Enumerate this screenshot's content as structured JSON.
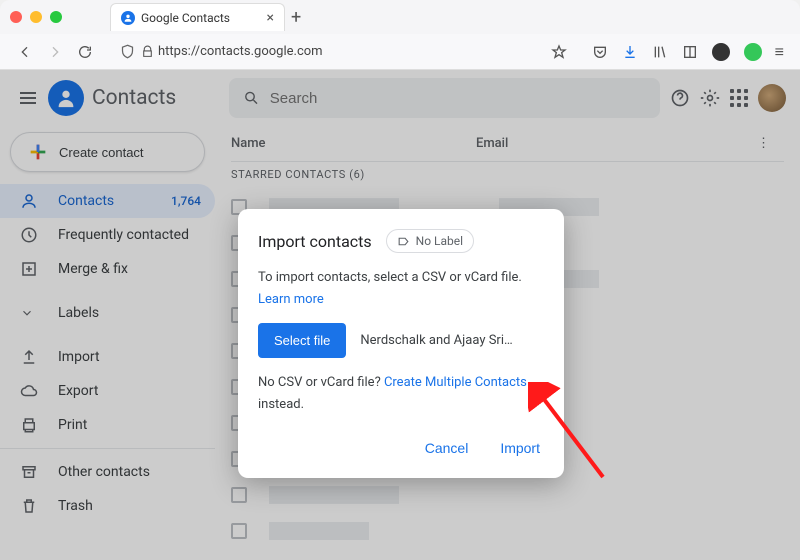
{
  "browser": {
    "tab_title": "Google Contacts",
    "url": "https://contacts.google.com"
  },
  "header": {
    "title": "Contacts"
  },
  "sidebar": {
    "create": "Create contact",
    "items": [
      {
        "label": "Contacts",
        "count": "1,764"
      },
      {
        "label": "Frequently contacted"
      },
      {
        "label": "Merge & fix"
      },
      {
        "label": "Labels"
      },
      {
        "label": "Import"
      },
      {
        "label": "Export"
      },
      {
        "label": "Print"
      },
      {
        "label": "Other contacts"
      },
      {
        "label": "Trash"
      }
    ]
  },
  "search": {
    "placeholder": "Search"
  },
  "table": {
    "name": "Name",
    "email": "Email",
    "section": "STARRED CONTACTS (6)"
  },
  "dialog": {
    "title": "Import contacts",
    "no_label": "No Label",
    "desc": "To import contacts, select a CSV or vCard file.",
    "learn_more": "Learn more",
    "select_file": "Select file",
    "filename": "Nerdschalk and Ajaay Srini…",
    "no_csv_pre": "No CSV or vCard file? ",
    "create_multiple": "Create Multiple Contacts",
    "no_csv_post": " instead.",
    "cancel": "Cancel",
    "import": "Import"
  }
}
